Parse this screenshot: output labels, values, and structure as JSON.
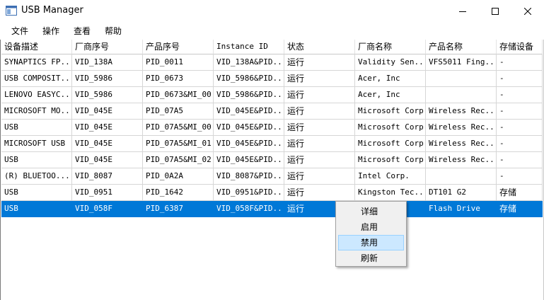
{
  "window": {
    "title": "USB Manager"
  },
  "menu": [
    "文件",
    "操作",
    "查看",
    "帮助"
  ],
  "columns": [
    "设备描述",
    "厂商序号",
    "产品序号",
    "Instance ID",
    "状态",
    "厂商名称",
    "产品名称",
    "存储设备"
  ],
  "rows": [
    [
      "SYNAPTICS FP...",
      "VID_138A",
      "PID_0011",
      "VID_138A&PID...",
      "运行",
      "Validity Sen...",
      "VFS5011 Fing...",
      "-"
    ],
    [
      "USB COMPOSIT...",
      "VID_5986",
      "PID_0673",
      "VID_5986&PID...",
      "运行",
      "Acer, Inc",
      "",
      "-"
    ],
    [
      "LENOVO EASYC...",
      "VID_5986",
      "PID_0673&MI_00",
      "VID_5986&PID...",
      "运行",
      "Acer, Inc",
      "",
      "-"
    ],
    [
      "MICROSOFT MO...",
      "VID_045E",
      "PID_07A5",
      "VID_045E&PID...",
      "运行",
      "Microsoft Corp.",
      "Wireless Rec...",
      "-"
    ],
    [
      "USB",
      "VID_045E",
      "PID_07A5&MI_00",
      "VID_045E&PID...",
      "运行",
      "Microsoft Corp.",
      "Wireless Rec...",
      "-"
    ],
    [
      "MICROSOFT  USB",
      "VID_045E",
      "PID_07A5&MI_01",
      "VID_045E&PID...",
      "运行",
      "Microsoft Corp.",
      "Wireless Rec...",
      "-"
    ],
    [
      "USB",
      "VID_045E",
      "PID_07A5&MI_02",
      "VID_045E&PID...",
      "运行",
      "Microsoft Corp.",
      "Wireless Rec...",
      "-"
    ],
    [
      "(R)  BLUETOO...",
      "VID_8087",
      "PID_0A2A",
      "VID_8087&PID...",
      "运行",
      "Intel Corp.",
      "",
      "-"
    ],
    [
      "USB",
      "VID_0951",
      "PID_1642",
      "VID_0951&PID...",
      "运行",
      "Kingston Tec...",
      "DT101 G2",
      "存储"
    ],
    [
      "USB",
      "VID_058F",
      "PID_6387",
      "VID_058F&PID...",
      "运行",
      "",
      "Flash Drive",
      "存储"
    ]
  ],
  "selected_row": 9,
  "context_menu": [
    "详细",
    "启用",
    "禁用",
    "刷新"
  ],
  "context_menu_highlighted": 2,
  "colors": {
    "selection": "#0078d7",
    "menu_hover": "#cce8ff",
    "menu_bg": "#f0f0f0"
  }
}
